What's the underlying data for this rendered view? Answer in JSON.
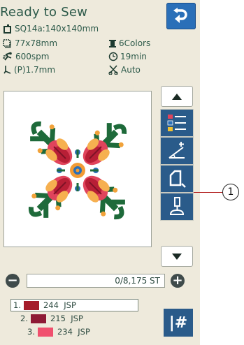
{
  "header": {
    "title": "Ready to Sew"
  },
  "info": {
    "design_name": "SQ14a:140x140mm",
    "design_size": "77x78mm",
    "color_count": "6Colors",
    "speed": "600spm",
    "time": "19min",
    "presser_foot": "(P)1.7mm",
    "thread_cut": "Auto"
  },
  "stitch": {
    "counter": "0/8,175 ST",
    "minus_label": "−",
    "plus_label": "+"
  },
  "colors": [
    {
      "index": "1.",
      "code": "244",
      "brand": "JSP",
      "color": "#a51c2a"
    },
    {
      "index": "2.",
      "code": "215",
      "brand": "JSP",
      "color": "#8e1a35"
    },
    {
      "index": "3.",
      "code": "234",
      "brand": "JSP",
      "color": "#f0506e"
    }
  ],
  "jump_label": "|#",
  "callout": {
    "number": "1"
  }
}
